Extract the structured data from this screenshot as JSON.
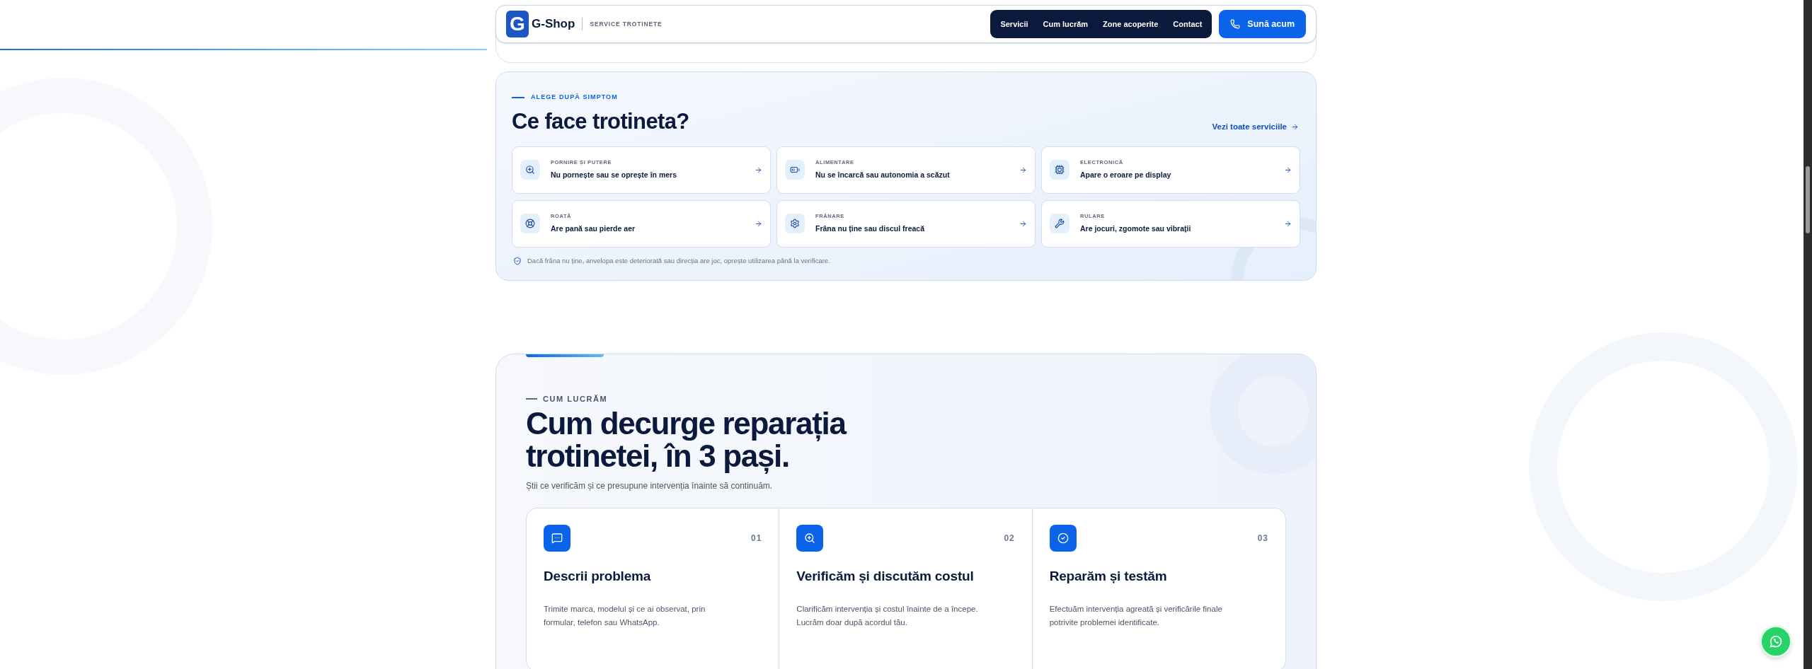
{
  "header": {
    "logo_mark": "G",
    "brand": "G-Shop",
    "tagline": "SERVICE TROTINETE",
    "nav": [
      {
        "label": "Servicii"
      },
      {
        "label": "Cum lucrăm"
      },
      {
        "label": "Zone acoperite"
      },
      {
        "label": "Contact"
      }
    ],
    "cta": "Sună acum"
  },
  "scroll_progress": {
    "level": 0.27
  },
  "symptoms": {
    "eyebrow": "ALEGE DUPĂ SIMPTOM",
    "title": "Ce face trotineta?",
    "link": "Vezi toate serviciile",
    "items": [
      {
        "category": "PORNIRE ȘI PUTERE",
        "text": "Nu pornește sau se oprește în mers"
      },
      {
        "category": "ALIMENTARE",
        "text": "Nu se încarcă sau autonomia a scăzut"
      },
      {
        "category": "ELECTRONICĂ",
        "text": "Apare o eroare pe display"
      },
      {
        "category": "ROATĂ",
        "text": "Are pană sau pierde aer"
      },
      {
        "category": "FRÂNARE",
        "text": "Frâna nu ține sau discul freacă"
      },
      {
        "category": "RULARE",
        "text": "Are jocuri, zgomote sau vibrații"
      }
    ],
    "note": "Dacă frâna nu ține, anvelopa este deteriorată sau direcția are joc, oprește utilizarea până la verificare."
  },
  "process": {
    "eyebrow": "CUM LUCRĂM",
    "title_lines": [
      "Cum decurge reparația",
      "trotinetei, în 3 pași."
    ],
    "subtitle": "Știi ce verificăm și ce presupune intervenția înainte să continuăm.",
    "steps": [
      {
        "number": "01",
        "title": "Descrii problema",
        "text": "Trimite marca, modelul și ce ai observat, prin formular, telefon sau WhatsApp."
      },
      {
        "number": "02",
        "title": "Verificăm și discutăm costul",
        "text": "Clarificăm intervenția și costul înainte de a începe. Lucrăm doar după acordul tău."
      },
      {
        "number": "03",
        "title": "Reparăm și testăm",
        "text": "Efectuăm intervenția agreată și verificările finale potrivite problemei identificate."
      }
    ]
  }
}
